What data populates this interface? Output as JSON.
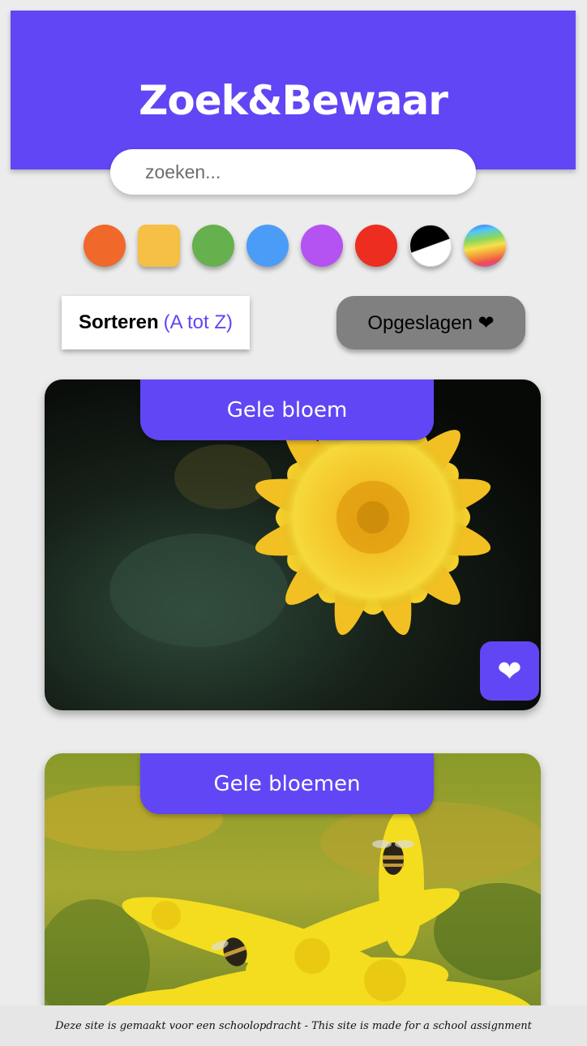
{
  "header": {
    "title": "Zoek&Bewaar"
  },
  "search": {
    "placeholder": "zoeken..."
  },
  "color_filters": [
    {
      "name": "orange",
      "color": "#f0682a"
    },
    {
      "name": "yellow",
      "color": "#f6bf45"
    },
    {
      "name": "green",
      "color": "#66b04e"
    },
    {
      "name": "blue",
      "color": "#4a9cf7"
    },
    {
      "name": "purple",
      "color": "#b552f2"
    },
    {
      "name": "red",
      "color": "#ec2d1f"
    },
    {
      "name": "black-white",
      "color": "#000000"
    },
    {
      "name": "rainbow",
      "color": "#ff8800"
    }
  ],
  "sort": {
    "label": "Sorteren",
    "order": "(A tot Z)"
  },
  "saved": {
    "label": "Opgeslagen ❤"
  },
  "cards": [
    {
      "title": "Gele bloem",
      "fav_icon": "❤"
    },
    {
      "title": "Gele bloemen"
    }
  ],
  "footer": {
    "text": "Deze site is gemaakt voor een schoolopdracht - This site is made for a school assignment"
  },
  "colors": {
    "accent": "#6146f5",
    "background": "#ececec",
    "saved_button": "#808080"
  }
}
